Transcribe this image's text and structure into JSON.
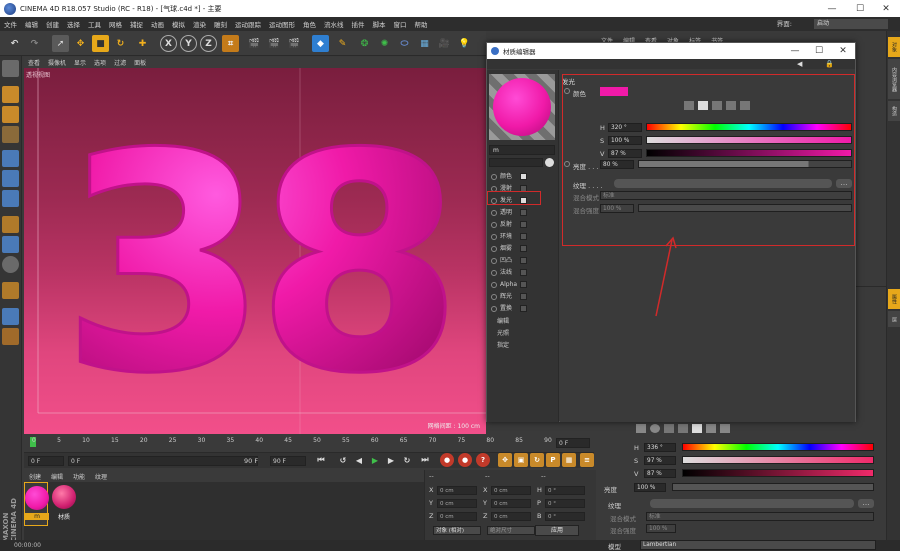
{
  "app": {
    "title": "CINEMA 4D R18.057 Studio (RC - R18) - [气球.c4d *] - 主要",
    "window_controls": [
      "—",
      "☐",
      "✕"
    ]
  },
  "menubar": {
    "items": [
      "文件",
      "编辑",
      "创建",
      "选择",
      "工具",
      "网格",
      "捕捉",
      "动画",
      "模拟",
      "渲染",
      "雕刻",
      "运动跟踪",
      "运动图形",
      "角色",
      "流水线",
      "插件",
      "脚本",
      "窗口",
      "帮助"
    ],
    "layout_label": "界面:",
    "layout_value": "启动"
  },
  "viewport": {
    "menu": [
      "查看",
      "摄像机",
      "显示",
      "选项",
      "过滤",
      "面板"
    ],
    "view_label": "透视视图",
    "grid_label": "网格间距 : 100 cm",
    "number_text": "38"
  },
  "timeline": {
    "ticks": [
      "0",
      "5",
      "10",
      "15",
      "20",
      "25",
      "30",
      "35",
      "40",
      "45",
      "50",
      "55",
      "60",
      "65",
      "70",
      "75",
      "80",
      "85",
      "90"
    ],
    "current_frame": "0 F",
    "start_frame": "0 F",
    "min_field": "0 F",
    "max_field": "90 F",
    "end_frame": "90 F"
  },
  "material_manager": {
    "menu": [
      "创建",
      "编辑",
      "功能",
      "纹理"
    ],
    "materials": [
      {
        "name": "m",
        "color": "#f01aa8"
      },
      {
        "name": "材质",
        "color": "#d02070"
      }
    ]
  },
  "coordinates": {
    "header_left": "--",
    "header_mid": "--",
    "header_right": "--",
    "rows": [
      {
        "a": "X",
        "av": "0 cm",
        "b": "X",
        "bv": "0 cm",
        "c": "H",
        "cv": "0 °"
      },
      {
        "a": "Y",
        "av": "0 cm",
        "b": "Y",
        "bv": "0 cm",
        "c": "P",
        "cv": "0 °"
      },
      {
        "a": "Z",
        "av": "0 cm",
        "b": "Z",
        "bv": "0 cm",
        "c": "B",
        "cv": "0 °"
      }
    ],
    "mode_select": "对象 (相对)",
    "size_select": "绝对尺寸",
    "apply": "应用"
  },
  "status": {
    "text": "00:00:00"
  },
  "right_panel": {
    "menu": [
      "文件",
      "编辑",
      "查看",
      "对象",
      "标签",
      "书签"
    ],
    "h_label": "H",
    "h_value": "336 °",
    "s_label": "S",
    "s_value": "97 %",
    "v_label": "V",
    "v_value": "87 %",
    "brightness_label": "亮度",
    "brightness_value": "100 %",
    "texture_label": "纹理",
    "mix_mode_label": "混合模式",
    "mix_mode_value": "标准",
    "mix_strength_label": "混合强度",
    "mix_strength_value": "100 %",
    "model_label": "模型",
    "model_value": "Lambertian",
    "side_tabs": [
      "对象",
      "内容浏览器",
      "构造",
      "属性",
      "层"
    ]
  },
  "material_editor": {
    "title": "材质编辑器",
    "material_name": "m",
    "channels": [
      {
        "label": "颜色",
        "checked": true
      },
      {
        "label": "漫射",
        "checked": false
      },
      {
        "label": "发光",
        "checked": true
      },
      {
        "label": "透明",
        "checked": false
      },
      {
        "label": "反射",
        "checked": false
      },
      {
        "label": "环境",
        "checked": false
      },
      {
        "label": "烟雾",
        "checked": false
      },
      {
        "label": "凹凸",
        "checked": false
      },
      {
        "label": "法线",
        "checked": false
      },
      {
        "label": "Alpha",
        "checked": false
      },
      {
        "label": "辉光",
        "checked": false
      },
      {
        "label": "置换",
        "checked": false
      }
    ],
    "sub_items": [
      "编辑",
      "光照",
      "指定"
    ],
    "section_title": "发光",
    "color_label": "颜色",
    "color_swatch": "#f01aa8",
    "h_label": "H",
    "h_value": "320 °",
    "s_label": "S",
    "s_value": "100 %",
    "v_label": "V",
    "v_value": "87 %",
    "brightness_label": "亮度 . . .",
    "brightness_value": "80 %",
    "texture_label": "纹理 . . . .",
    "mix_mode_label": "混合模式",
    "mix_mode_value": "标准",
    "mix_strength_label": "混合强度",
    "mix_strength_value": "100 %"
  },
  "colors": {
    "accent_magenta": "#f01aa8",
    "highlight_red": "#d12a2a",
    "panel_bg": "#3a3a3a"
  }
}
